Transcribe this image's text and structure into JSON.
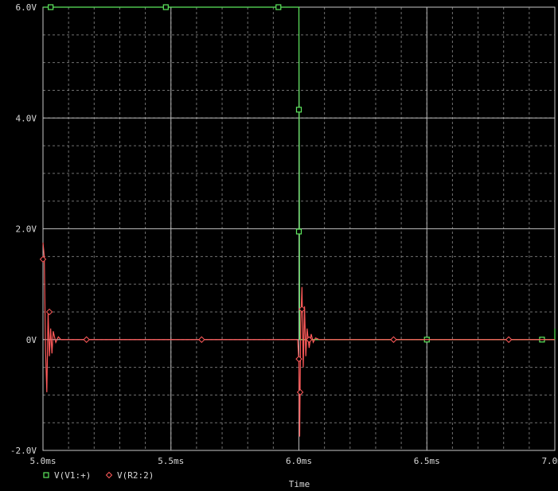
{
  "chart_data": {
    "type": "line",
    "title": "",
    "xlabel": "Time",
    "ylabel": "",
    "xlim": [
      5.0,
      7.0
    ],
    "ylim": [
      -2.0,
      6.0
    ],
    "x_unit": "ms",
    "y_unit": "V",
    "grid": true,
    "background": "#000000",
    "grid_color": "#a0a0a0",
    "x_ticks": [
      {
        "value": 5.0,
        "label": "5.0ms"
      },
      {
        "value": 5.5,
        "label": "5.5ms"
      },
      {
        "value": 6.0,
        "label": "6.0ms"
      },
      {
        "value": 6.5,
        "label": "6.5ms"
      },
      {
        "value": 7.0,
        "label": "7.0ms"
      }
    ],
    "y_ticks": [
      {
        "value": 6.0,
        "label": "6.0V"
      },
      {
        "value": 4.0,
        "label": "4.0V"
      },
      {
        "value": 2.0,
        "label": "2.0V"
      },
      {
        "value": 0.0,
        "label": "0V"
      },
      {
        "value": -2.0,
        "label": "-2.0V"
      }
    ],
    "legend_position": "bottom-left",
    "series": [
      {
        "name": "V(V1:+)",
        "color": "#5ee85e",
        "marker": "square",
        "points": [
          [
            5.0,
            6.0
          ],
          [
            5.99,
            6.0
          ],
          [
            6.0,
            6.0
          ],
          [
            6.001,
            4.0
          ],
          [
            6.002,
            2.0
          ],
          [
            6.003,
            0.0
          ],
          [
            7.0,
            0.0
          ],
          [
            7.0,
            0.2
          ]
        ],
        "marker_points": [
          [
            5.03,
            6.0
          ],
          [
            5.48,
            6.0
          ],
          [
            5.92,
            6.0
          ],
          [
            6.0,
            4.15
          ],
          [
            6.0,
            1.95
          ],
          [
            6.5,
            0.0
          ],
          [
            6.95,
            0.0
          ]
        ]
      },
      {
        "name": "V(R2:2)",
        "color": "#ff5a5a",
        "marker": "diamond",
        "points": [
          [
            5.0,
            1.75
          ],
          [
            5.005,
            1.5
          ],
          [
            5.01,
            -0.2
          ],
          [
            5.015,
            -0.95
          ],
          [
            5.02,
            0.5
          ],
          [
            5.025,
            -0.3
          ],
          [
            5.03,
            0.2
          ],
          [
            5.035,
            -0.25
          ],
          [
            5.04,
            0.15
          ],
          [
            5.05,
            -0.05
          ],
          [
            5.06,
            0.05
          ],
          [
            5.07,
            0.0
          ],
          [
            5.995,
            0.0
          ],
          [
            6.0,
            -0.4
          ],
          [
            6.003,
            -1.75
          ],
          [
            6.007,
            0.3
          ],
          [
            6.012,
            0.95
          ],
          [
            6.017,
            -0.5
          ],
          [
            6.022,
            0.6
          ],
          [
            6.027,
            -0.3
          ],
          [
            6.032,
            0.2
          ],
          [
            6.04,
            -0.15
          ],
          [
            6.048,
            0.1
          ],
          [
            6.056,
            -0.05
          ],
          [
            6.065,
            0.03
          ],
          [
            6.08,
            0.0
          ],
          [
            7.0,
            0.0
          ]
        ],
        "marker_points": [
          [
            5.0,
            1.45
          ],
          [
            5.025,
            0.5
          ],
          [
            5.17,
            0.0
          ],
          [
            5.62,
            0.0
          ],
          [
            6.0,
            -0.35
          ],
          [
            6.005,
            -0.95
          ],
          [
            6.012,
            0.55
          ],
          [
            6.04,
            0.0
          ],
          [
            6.37,
            0.0
          ],
          [
            6.82,
            0.0
          ]
        ]
      }
    ]
  },
  "legend": {
    "items": [
      {
        "label": "V(V1:+)",
        "color": "#5ee85e",
        "marker": "square"
      },
      {
        "label": "V(R2:2)",
        "color": "#ff5a5a",
        "marker": "diamond"
      }
    ]
  },
  "x_axis_title": "Time"
}
